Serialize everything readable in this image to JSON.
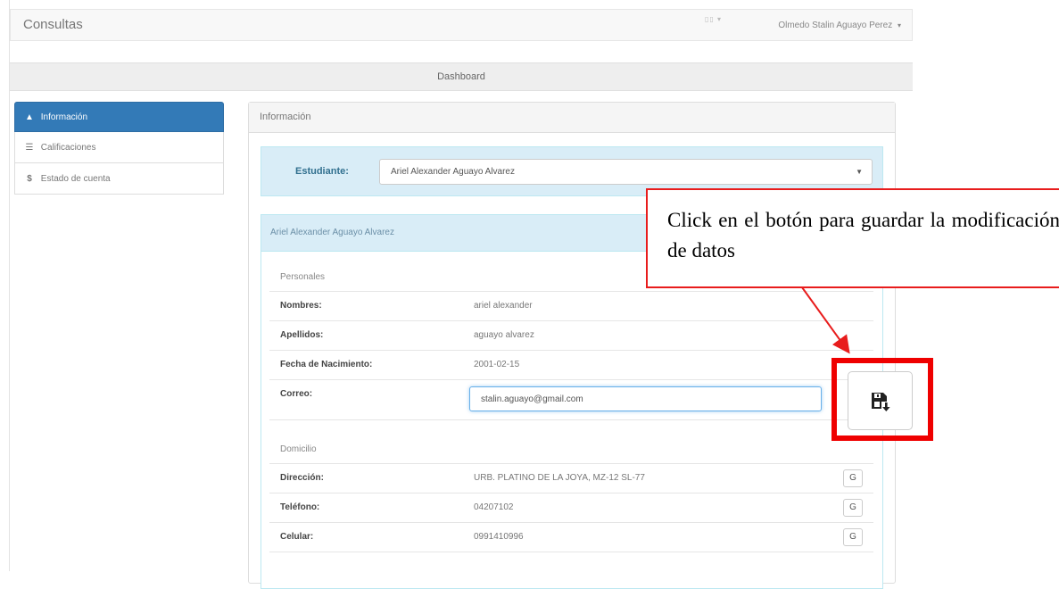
{
  "navbar": {
    "brand": "Consultas",
    "mini_icon": "▯▯ ▾",
    "user_name": "Olmedo Stalin Aguayo Perez",
    "user_caret": "▾"
  },
  "dashboard_label": "Dashboard",
  "sidebar": {
    "items": [
      {
        "icon": "user-icon",
        "glyph": "▲",
        "label": "Información",
        "active": true
      },
      {
        "icon": "list-icon",
        "glyph": "☰",
        "label": "Calificaciones",
        "active": false
      },
      {
        "icon": "dollar-icon",
        "glyph": "$",
        "label": "Estado de cuenta",
        "active": false
      }
    ]
  },
  "main": {
    "title": "Información",
    "student_label": "Estudiante:",
    "student_selected": "Ariel Alexander Aguayo Alvarez",
    "select_arrow": "▼",
    "info_header": "Ariel Alexander Aguayo Alvarez",
    "personal": {
      "title": "Personales",
      "nombres_label": "Nombres:",
      "nombres_value": "ariel alexander",
      "apellidos_label": "Apellidos:",
      "apellidos_value": "aguayo alvarez",
      "fecha_label": "Fecha de Nacimiento:",
      "fecha_value": "2001-02-15",
      "correo_label": "Correo:",
      "correo_value": "stalin.aguayo@gmail.com"
    },
    "domicilio": {
      "title": "Domicilio",
      "direccion_label": "Dirección:",
      "direccion_value": "URB. PLATINO DE LA JOYA, MZ-12 SL-77",
      "telefono_label": "Teléfono:",
      "telefono_value": "04207102",
      "celular_label": "Celular:",
      "celular_value": "0991410996",
      "edit_glyph": "G"
    }
  },
  "annotation": {
    "text": "Click en el botón para guardar la modificación de datos"
  },
  "colors": {
    "primary": "#337ab7",
    "info_bg": "#d9edf7",
    "annotation_red": "#e81c1c"
  }
}
